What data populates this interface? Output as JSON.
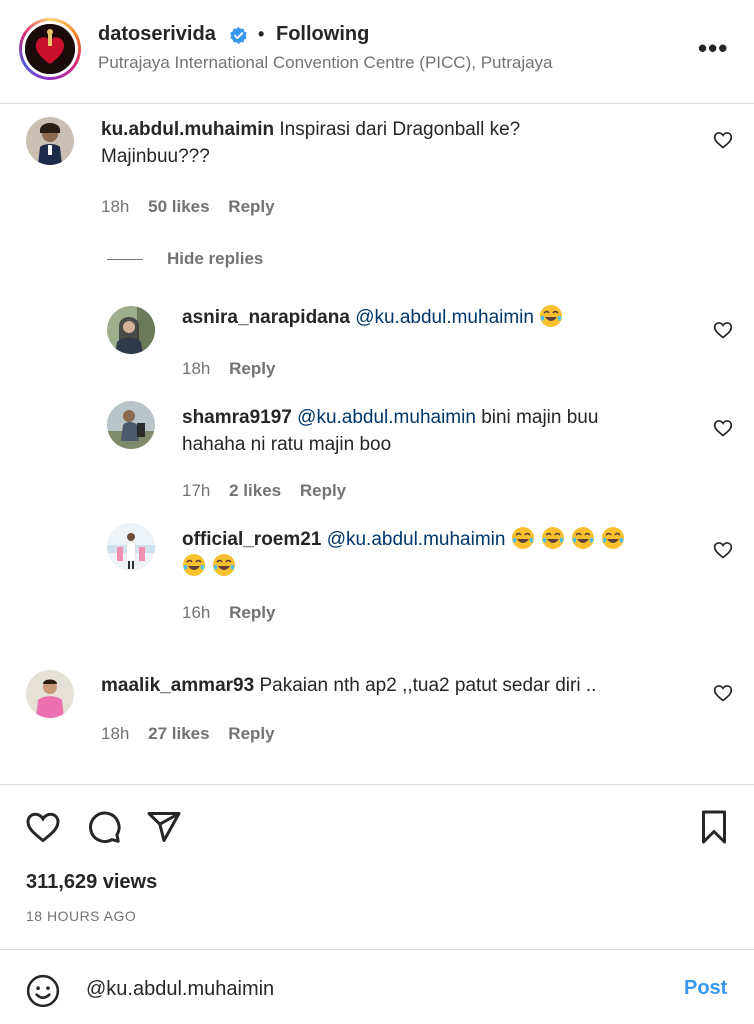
{
  "header": {
    "username": "datoserivida",
    "separator": "•",
    "following_label": "Following",
    "location": "Putrajaya International Convention Centre (PICC), Putrajaya"
  },
  "comments": [
    {
      "username": "ku.abdul.muhaimin",
      "text": "Inspirasi dari Dragonball ke?",
      "text_line2": "Majinbuu???",
      "time": "18h",
      "likes": "50 likes",
      "reply_label": "Reply",
      "hide_replies": "Hide replies",
      "replies": [
        {
          "username": "asnira_narapidana",
          "mention": "@ku.abdul.muhaimin",
          "text": "",
          "text_line2": "",
          "emoji": "face-with-tears-of-joy",
          "emoji_count": 1,
          "time": "18h",
          "likes": "",
          "reply_label": "Reply"
        },
        {
          "username": "shamra9197",
          "mention": "@ku.abdul.muhaimin",
          "text": "bini majin buu",
          "text_line2": "hahaha ni ratu majin boo",
          "time": "17h",
          "likes": "2 likes",
          "reply_label": "Reply"
        },
        {
          "username": "official_roem21",
          "mention": "@ku.abdul.muhaimin",
          "text": "",
          "emoji": "face-with-tears-of-joy",
          "emoji_count": 6,
          "time": "16h",
          "likes": "",
          "reply_label": "Reply"
        }
      ]
    },
    {
      "username": "maalik_ammar93",
      "text": "Pakaian nth ap2 ,,tua2 patut sedar diri ..",
      "time": "18h",
      "likes": "27 likes",
      "reply_label": "Reply"
    }
  ],
  "stats": {
    "views": "311,629 views",
    "posted_ago": "18 HOURS AGO"
  },
  "composer": {
    "value": "@ku.abdul.muhaimin",
    "post_label": "Post"
  },
  "icons": [
    "heart-icon",
    "comment-icon",
    "share-icon",
    "bookmark-icon",
    "emoji-icon",
    "verified-icon",
    "more-options-icon"
  ],
  "colors": {
    "link": "#00376b",
    "post": "#3897f0",
    "muted": "#737373",
    "verified": "#3897f0"
  }
}
